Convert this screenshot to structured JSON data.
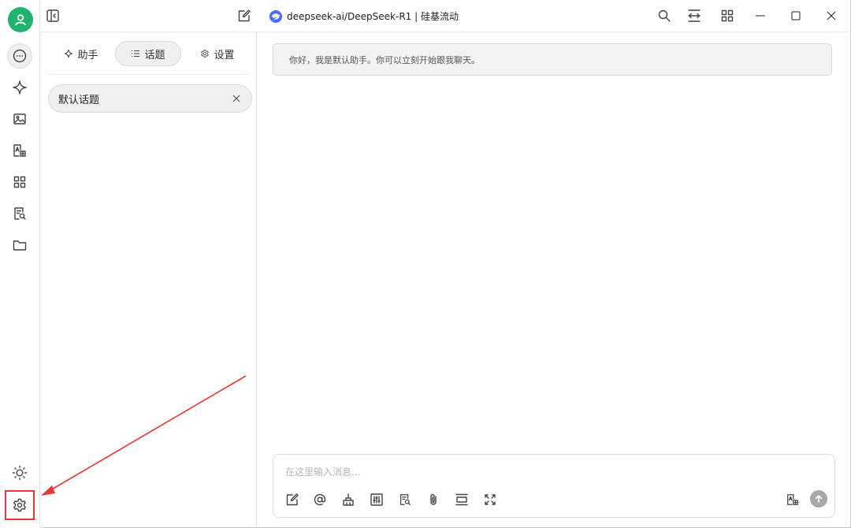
{
  "window": {
    "model_title": "deepseek-ai/DeepSeek-R1 | 硅基流动"
  },
  "sidebar_tabs": [
    {
      "label": "助手",
      "icon": "sparkle-icon"
    },
    {
      "label": "话题",
      "icon": "list-icon",
      "active": true
    },
    {
      "label": "设置",
      "icon": "gear-icon"
    }
  ],
  "topics": [
    {
      "label": "默认话题"
    }
  ],
  "chat": {
    "greeting": "你好，我是默认助手。你可以立刻开始跟我聊天。"
  },
  "input": {
    "placeholder": "在这里输入消息..."
  },
  "rail_icons": [
    "chat-icon",
    "sparkle-icon",
    "image-icon",
    "translate-icon",
    "apps-icon",
    "knowledge-icon",
    "folder-icon",
    "sun-icon",
    "gear-icon"
  ],
  "colors": {
    "avatar": "#1fb36e",
    "highlight": "#e53935",
    "model_logo": "#4d6bfe"
  }
}
